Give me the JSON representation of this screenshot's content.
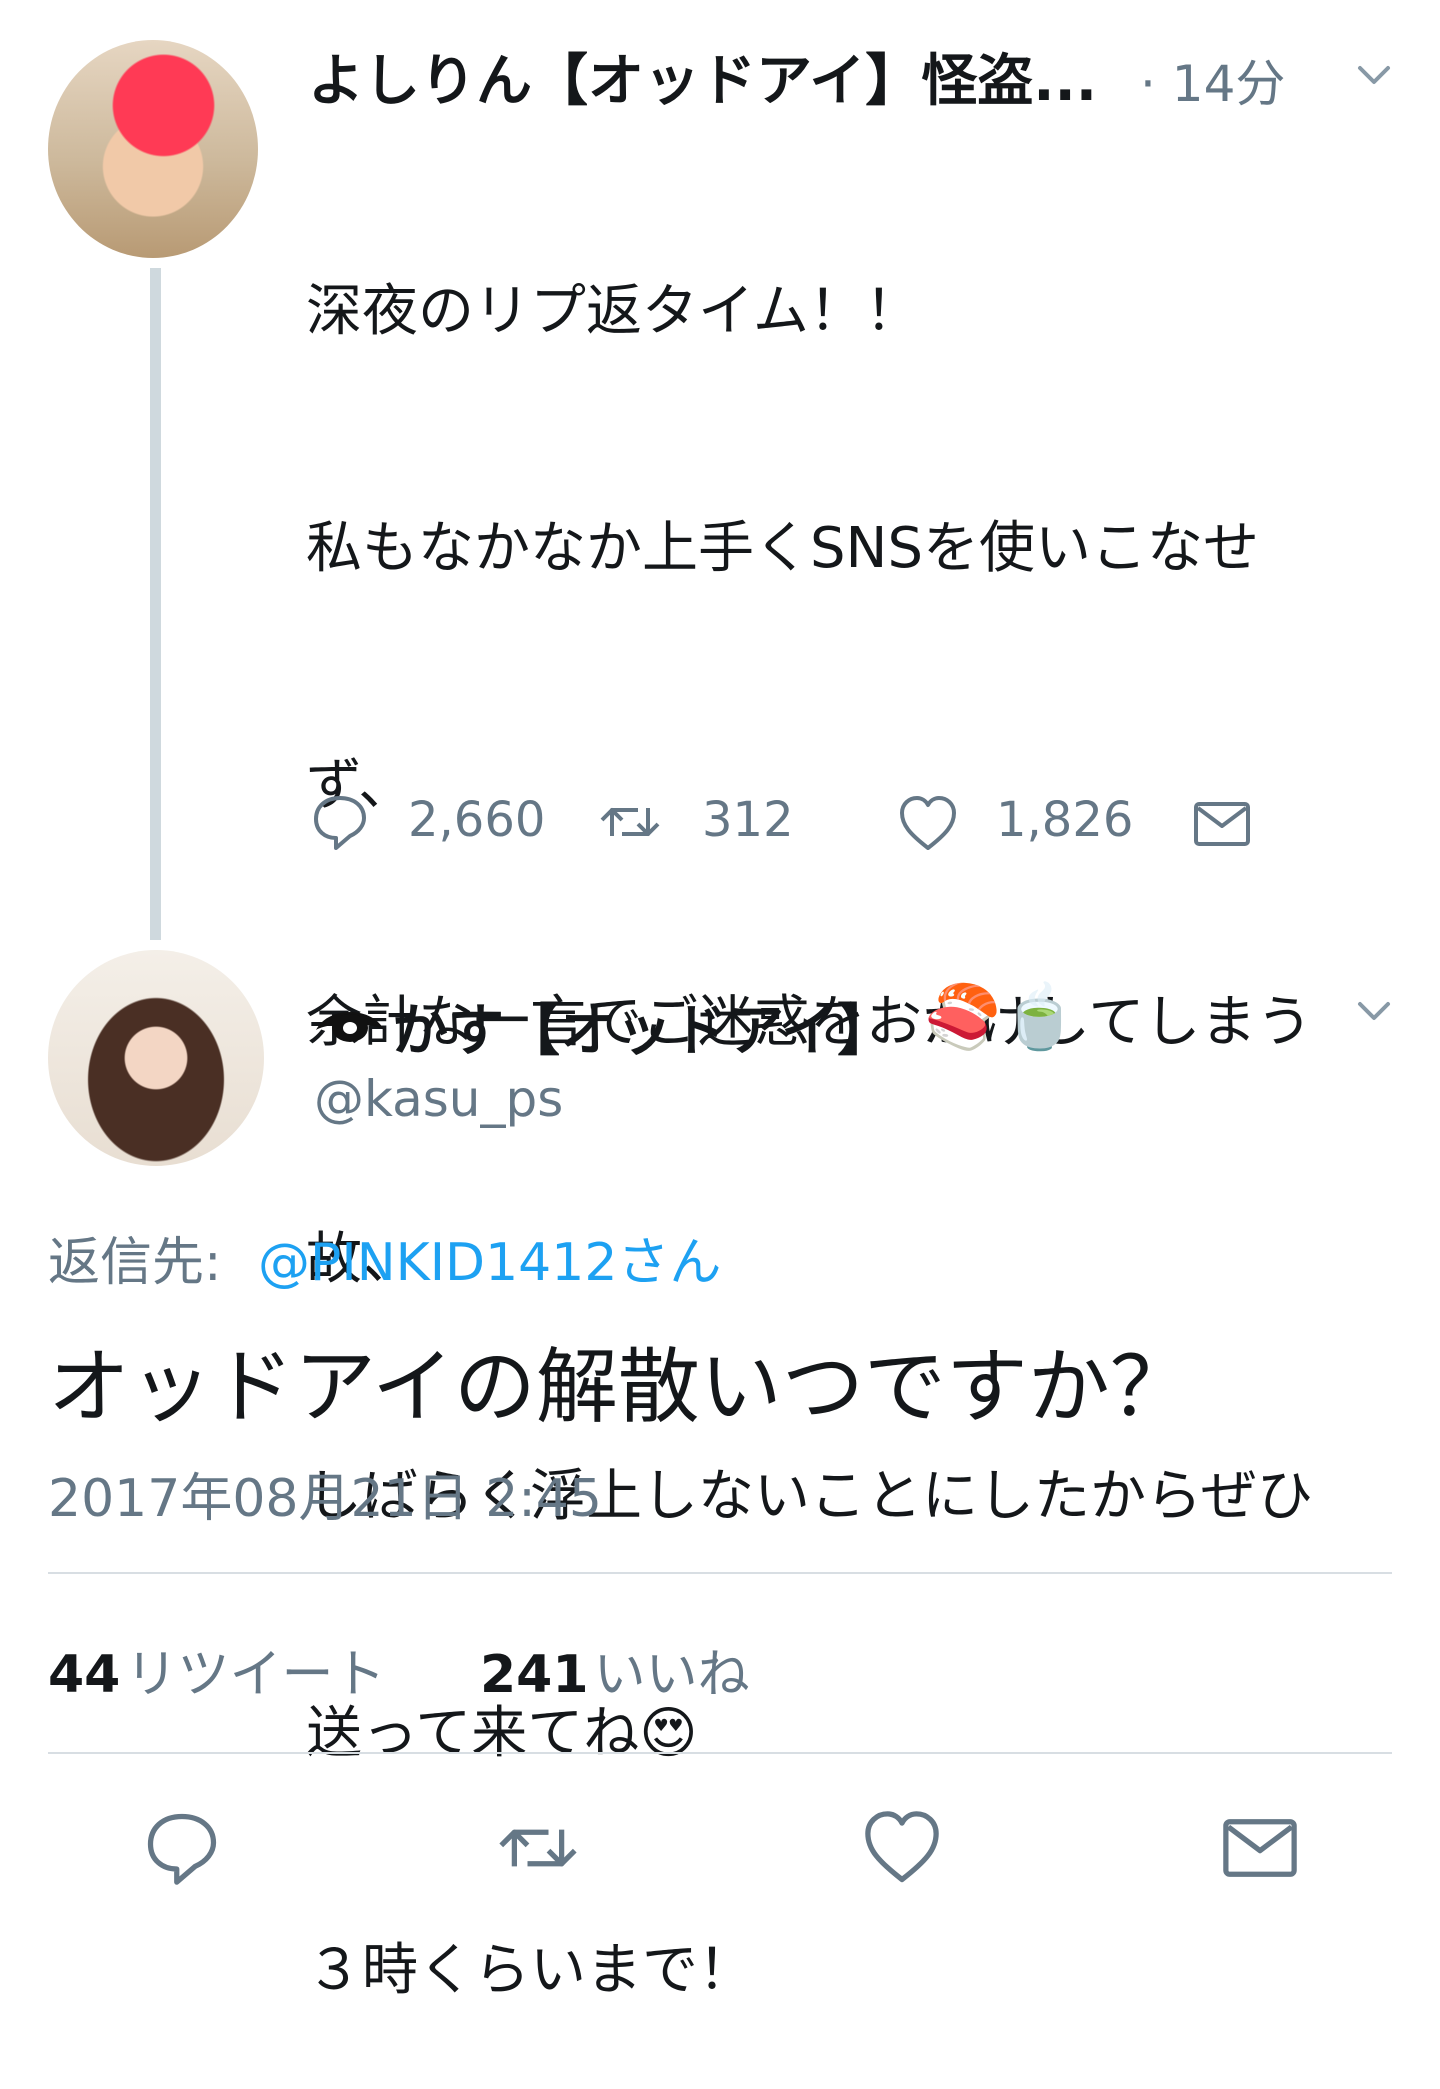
{
  "tweet1": {
    "display_name": "よしりん【オッドアイ】怪盗...",
    "time": "· 14分",
    "body_lines": [
      "深夜のリプ返タイム！！",
      "私もなかなか上手くSNSを使いこなせ",
      "ず、",
      "余計な一言でご迷惑をおかけしてしまう",
      "故、",
      "しばらく浮上しないことにしたからぜひ",
      "送って来てね😍",
      "３時くらいまで！"
    ],
    "replies": "2,660",
    "retweets": "312",
    "likes": "1,826"
  },
  "tweet2": {
    "display_name": "かす【オッドアイ】",
    "emoji": "🍣🍵",
    "handle": "@kasu_ps",
    "reply_prefix": "返信先:",
    "reply_to": "@PINKID1412さん",
    "body": "オッドアイの解散いつですか？",
    "date": "2017年08月21日 2:45",
    "retweet_count": "44",
    "retweet_label": "リツイート",
    "like_count": "241",
    "like_label": "いいね"
  },
  "icons": {
    "chevron": "chevron-down-icon",
    "reply": "reply-icon",
    "retweet": "retweet-icon",
    "like": "heart-icon",
    "dm": "envelope-icon",
    "eye": "eye-icon"
  },
  "colors": {
    "link": "#1da1f2",
    "secondary": "#657786",
    "thread_line": "#cfd9de"
  }
}
